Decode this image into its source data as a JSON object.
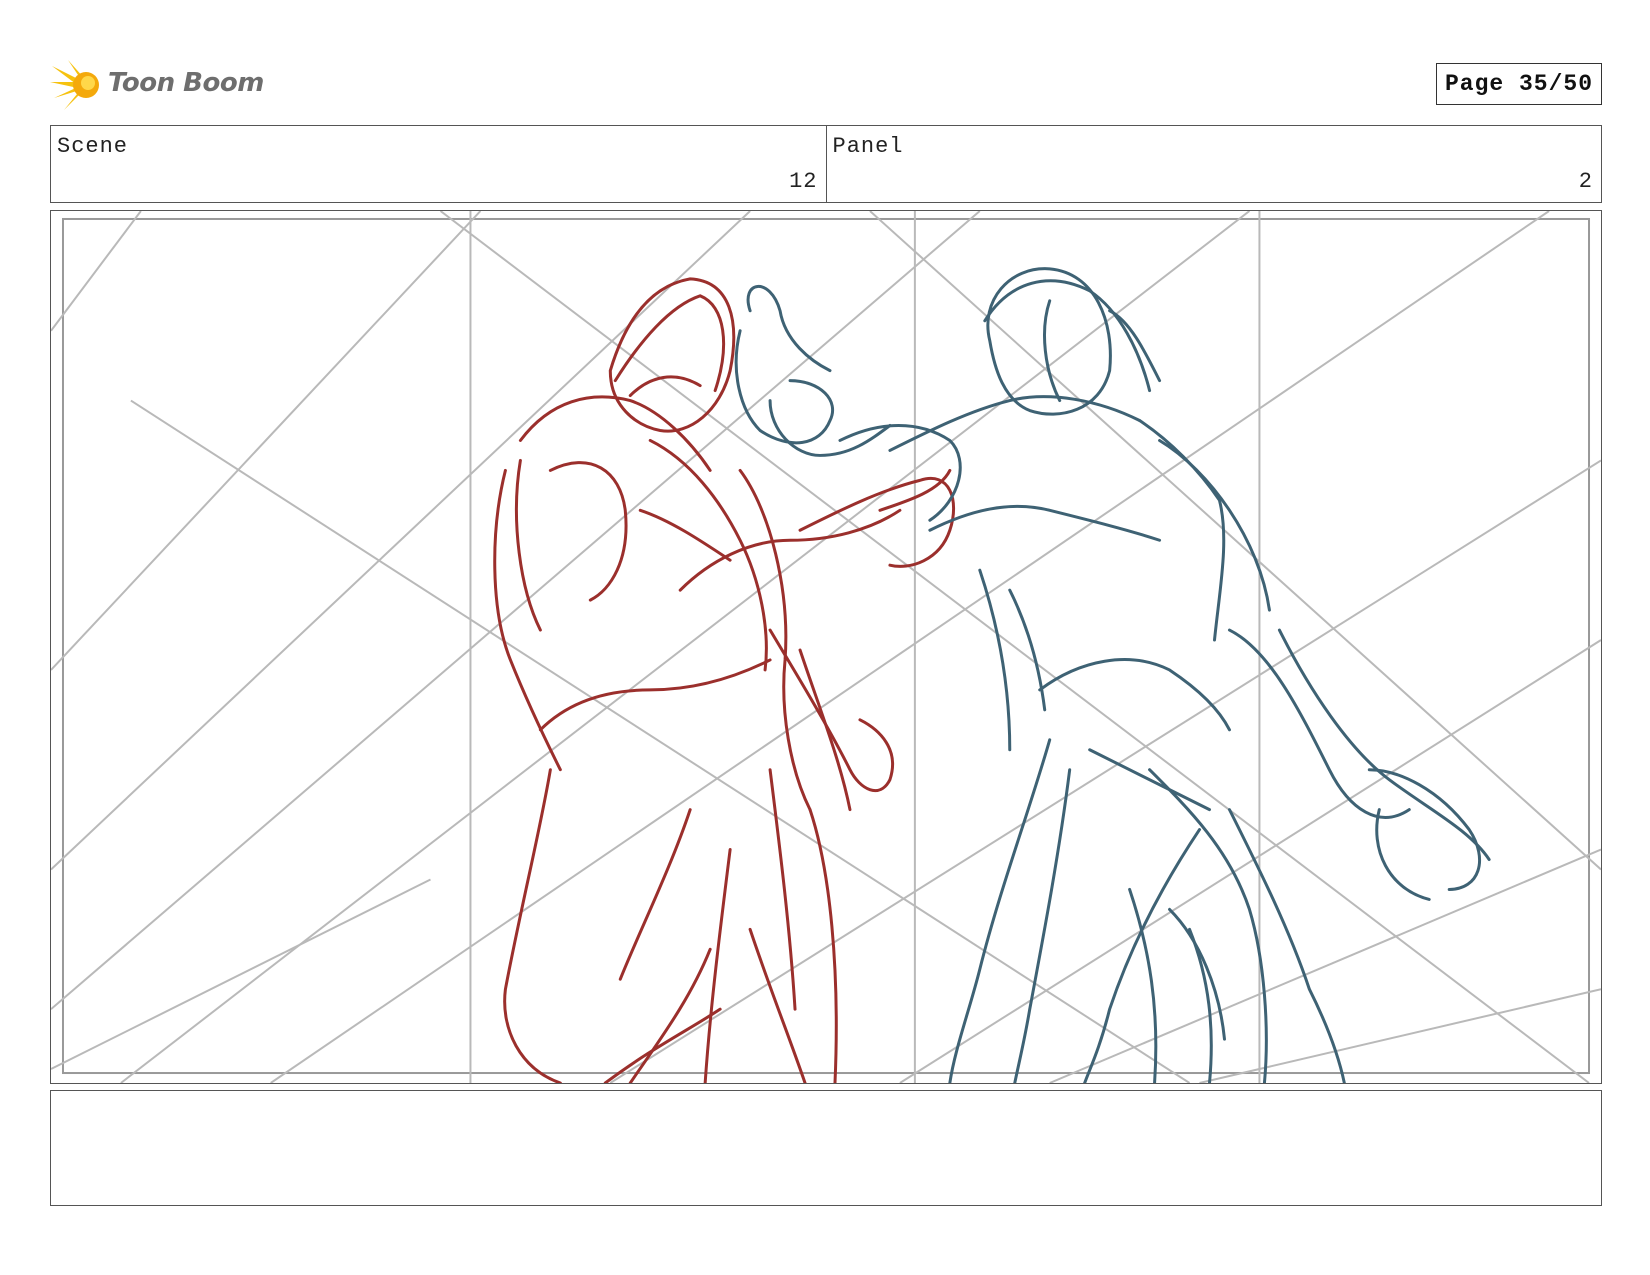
{
  "header": {
    "logo_text": "Toon Boom",
    "page_label": "Page 35/50"
  },
  "info": {
    "scene_label": "Scene",
    "scene_value": "12",
    "panel_label": "Panel",
    "panel_value": "2"
  },
  "panel_art": {
    "figure_left_color": "#9b2f2c",
    "figure_right_color": "#3e6274",
    "guide_color": "#b9b9b9"
  },
  "notes": {
    "text": ""
  }
}
